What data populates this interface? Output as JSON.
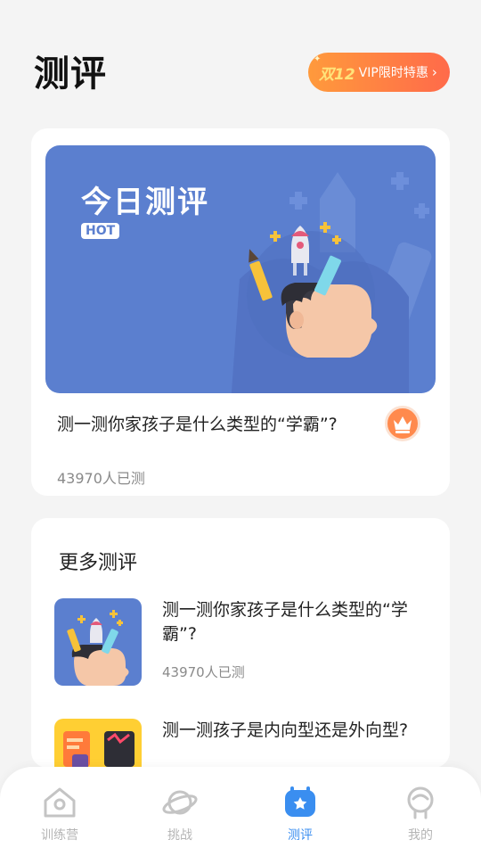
{
  "header": {
    "title": "测评"
  },
  "vip": {
    "promo": "双12",
    "label": "VIP限时特惠",
    "chevron": "›"
  },
  "today": {
    "banner_title": "今日测评",
    "hot_badge": "HOT",
    "question": "测一测你家孩子是什么类型的“学霸”?",
    "count": "43970人已测",
    "crown_icon": "crown-icon"
  },
  "more": {
    "title": "更多测评",
    "items": [
      {
        "title": "测一测你家孩子是什么类型的“学霸”?",
        "count": "43970人已测",
        "thumb_color": "#5b7fcf"
      },
      {
        "title": "测一测孩子是内向型还是外向型?",
        "count": "",
        "thumb_color": "#ffcf33"
      }
    ]
  },
  "tabs": [
    {
      "label": "训练营",
      "icon": "home-icon",
      "active": false
    },
    {
      "label": "挑战",
      "icon": "planet-icon",
      "active": false
    },
    {
      "label": "测评",
      "icon": "assessment-icon",
      "active": true
    },
    {
      "label": "我的",
      "icon": "profile-icon",
      "active": false
    }
  ],
  "colors": {
    "accent": "#3a8ef0",
    "banner": "#5b7fcf",
    "vip_start": "#ff9a3c",
    "vip_end": "#ff6a4a"
  }
}
